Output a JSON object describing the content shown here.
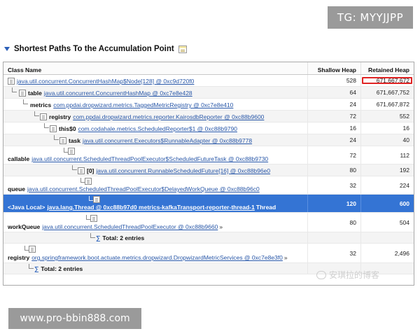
{
  "watermark_top": "TG: MYYJJPP",
  "watermark_bottom": "www.pro-bbin888.com",
  "wechat_watermark": "安琪拉的博客",
  "section": {
    "title": "Shortest Paths To the Accumulation Point"
  },
  "table": {
    "headers": {
      "class_name": "Class Name",
      "shallow": "Shallow Heap",
      "retained": "Retained Heap"
    },
    "rows": [
      {
        "ref": "",
        "cls": "java.util.concurrent.ConcurrentHashMap$Node[128] @ 0xc9d720f0",
        "suffix": "",
        "shallow": "528",
        "retained": "671,667,672"
      },
      {
        "ref": "table",
        "cls": "java.util.concurrent.ConcurrentHashMap @ 0xc7e8e428",
        "suffix": "",
        "shallow": "64",
        "retained": "671,667,752"
      },
      {
        "ref": "metrics",
        "cls": "com.ppdai.dropwizard.metrics.TaggedMetricRegistry @ 0xc7e8e410",
        "suffix": "",
        "shallow": "24",
        "retained": "671,667,872"
      },
      {
        "ref": "registry",
        "cls": "com.ppdai.dropwizard.metrics.reporter.KairosdbReporter @ 0xc88b9600",
        "suffix": "",
        "shallow": "72",
        "retained": "552"
      },
      {
        "ref": "this$0",
        "cls": "com.codahale.metrics.ScheduledReporter$1 @ 0xc88b9790",
        "suffix": "",
        "shallow": "16",
        "retained": "16"
      },
      {
        "ref": "task",
        "cls": "java.util.concurrent.Executors$RunnableAdapter @ 0xc88b9778",
        "suffix": "",
        "shallow": "24",
        "retained": "40"
      },
      {
        "ref": "callable",
        "cls": "java.util.concurrent.ScheduledThreadPoolExecutor$ScheduledFutureTask @ 0xc88b9730",
        "suffix": "",
        "shallow": "72",
        "retained": "112"
      },
      {
        "ref": "[0]",
        "cls": "java.util.concurrent.RunnableScheduledFuture[16] @ 0xc88b96e0",
        "suffix": "",
        "shallow": "80",
        "retained": "192"
      },
      {
        "ref": "queue",
        "cls": "java.util.concurrent.ScheduledThreadPoolExecutor$DelayedWorkQueue @ 0xc88b96c0",
        "suffix": "",
        "shallow": "32",
        "retained": "224"
      },
      {
        "ref": "<Java Local>",
        "cls": "java.lang.Thread @ 0xc88b97d0  metrics-kafkaTransport-reporter-thread-1",
        "suffix": "Thread",
        "shallow": "120",
        "retained": "600"
      },
      {
        "ref": "workQueue",
        "cls": "java.util.concurrent.ScheduledThreadPoolExecutor @ 0xc88b9660",
        "suffix": "»",
        "shallow": "80",
        "retained": "504"
      },
      {
        "ref": "registry",
        "cls": "org.springframework.boot.actuate.metrics.dropwizard.DropwizardMetricServices @ 0xc7e8e3f0",
        "suffix": "»",
        "shallow": "32",
        "retained": "2,496"
      }
    ],
    "totals": {
      "t1": "Total: 2 entries",
      "t2": "Total: 2 entries"
    }
  },
  "colors": {
    "selection": "#3474d4",
    "link": "#2857a8",
    "highlight": "#e02424"
  }
}
